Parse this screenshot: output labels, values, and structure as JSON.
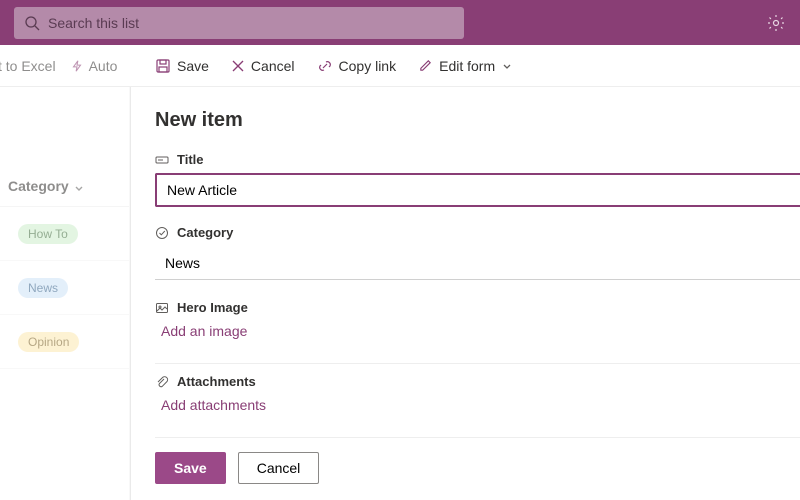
{
  "topbar": {
    "search_placeholder": "Search this list"
  },
  "cmdrow": {
    "export_label": "t to Excel",
    "automate_label": "Auto"
  },
  "panel_cmds": {
    "save": "Save",
    "cancel": "Cancel",
    "copylink": "Copy link",
    "editform": "Edit form"
  },
  "list": {
    "column": "Category",
    "rows": [
      "How To",
      "News",
      "Opinion"
    ]
  },
  "form": {
    "heading": "New item",
    "title_label": "Title",
    "title_value": "New Article",
    "category_label": "Category",
    "category_value": "News",
    "hero_label": "Hero Image",
    "hero_action": "Add an image",
    "attach_label": "Attachments",
    "attach_action": "Add attachments",
    "save_btn": "Save",
    "cancel_btn": "Cancel"
  }
}
